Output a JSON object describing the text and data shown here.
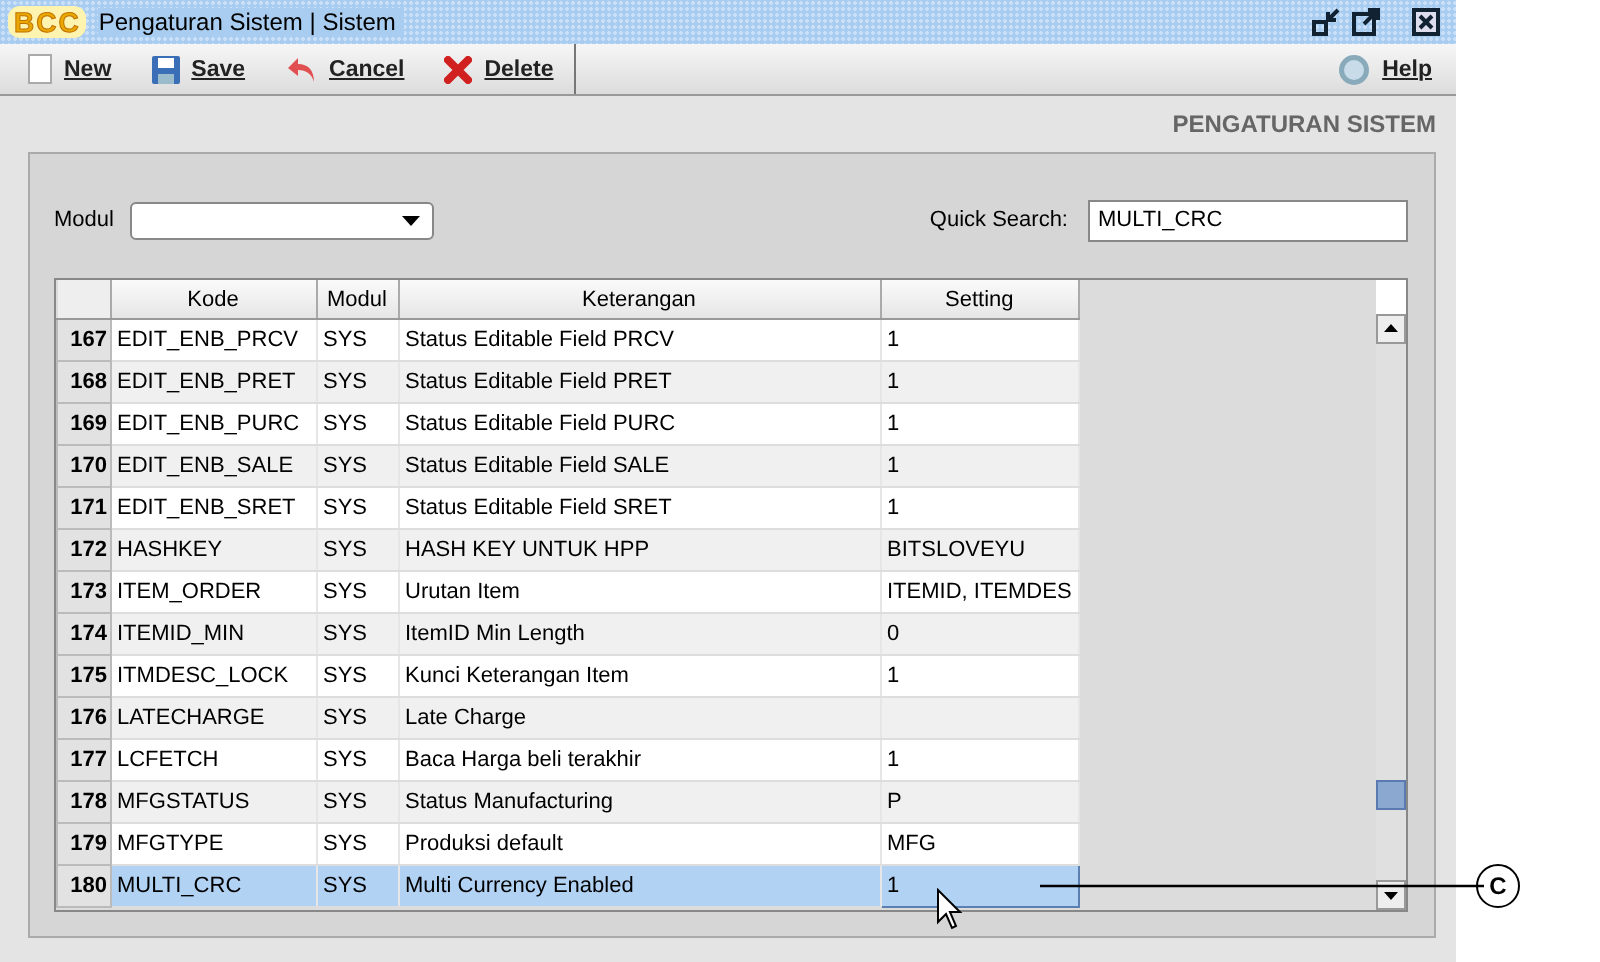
{
  "window": {
    "title": "Pengaturan Sistem | Sistem",
    "logo": "BCC"
  },
  "toolbar": {
    "buttons": [
      {
        "kind": "new",
        "label": "New"
      },
      {
        "kind": "save",
        "label": "Save"
      },
      {
        "kind": "cancel",
        "label": "Cancel"
      },
      {
        "kind": "delete",
        "label": "Delete"
      }
    ],
    "help": "Help"
  },
  "page_title": "PENGATURAN SISTEM",
  "filters": {
    "modul_label": "Modul",
    "quick_search_label": "Quick Search:",
    "quick_search_value": "MULTI_CRC"
  },
  "table": {
    "columns": [
      "Kode",
      "Modul",
      "Keterangan",
      "Setting"
    ],
    "rows": [
      {
        "number": "167",
        "kode": "EDIT_ENB_PRCV",
        "modul": "SYS",
        "keterangan": "Status Editable Field PRCV",
        "setting": "1",
        "selected": false
      },
      {
        "number": "168",
        "kode": "EDIT_ENB_PRET",
        "modul": "SYS",
        "keterangan": "Status Editable Field PRET",
        "setting": "1",
        "selected": false
      },
      {
        "number": "169",
        "kode": "EDIT_ENB_PURC",
        "modul": "SYS",
        "keterangan": "Status Editable Field PURC",
        "setting": "1",
        "selected": false
      },
      {
        "number": "170",
        "kode": "EDIT_ENB_SALE",
        "modul": "SYS",
        "keterangan": "Status Editable Field SALE",
        "setting": "1",
        "selected": false
      },
      {
        "number": "171",
        "kode": "EDIT_ENB_SRET",
        "modul": "SYS",
        "keterangan": "Status Editable Field SRET",
        "setting": "1",
        "selected": false
      },
      {
        "number": "172",
        "kode": "HASHKEY",
        "modul": "SYS",
        "keterangan": "HASH KEY UNTUK HPP",
        "setting": "BITSLOVEYU",
        "selected": false
      },
      {
        "number": "173",
        "kode": "ITEM_ORDER",
        "modul": "SYS",
        "keterangan": "Urutan Item",
        "setting": "ITEMID, ITEMDES",
        "selected": false
      },
      {
        "number": "174",
        "kode": "ITEMID_MIN",
        "modul": "SYS",
        "keterangan": "ItemID Min Length",
        "setting": "0",
        "selected": false
      },
      {
        "number": "175",
        "kode": "ITMDESC_LOCK",
        "modul": "SYS",
        "keterangan": "Kunci Keterangan Item",
        "setting": "1",
        "selected": false
      },
      {
        "number": "176",
        "kode": "LATECHARGE",
        "modul": "SYS",
        "keterangan": "Late Charge",
        "selected": false
      },
      {
        "number": "177",
        "kode": "LCFETCH",
        "modul": "SYS",
        "keterangan": "Baca Harga beli terakhir",
        "setting": "1",
        "selected": false
      },
      {
        "number": "178",
        "kode": "MFGSTATUS",
        "modul": "SYS",
        "keterangan": "Status Manufacturing",
        "setting": "P",
        "selected": false
      },
      {
        "number": "179",
        "kode": "MFGTYPE",
        "modul": "SYS",
        "keterangan": "Produksi default",
        "setting": "MFG",
        "selected": false
      },
      {
        "number": "180",
        "kode": "MULTI_CRC",
        "modul": "SYS",
        "keterangan": "Multi Currency Enabled",
        "setting": "1",
        "selected": true
      }
    ]
  },
  "callout": {
    "label": "C"
  }
}
